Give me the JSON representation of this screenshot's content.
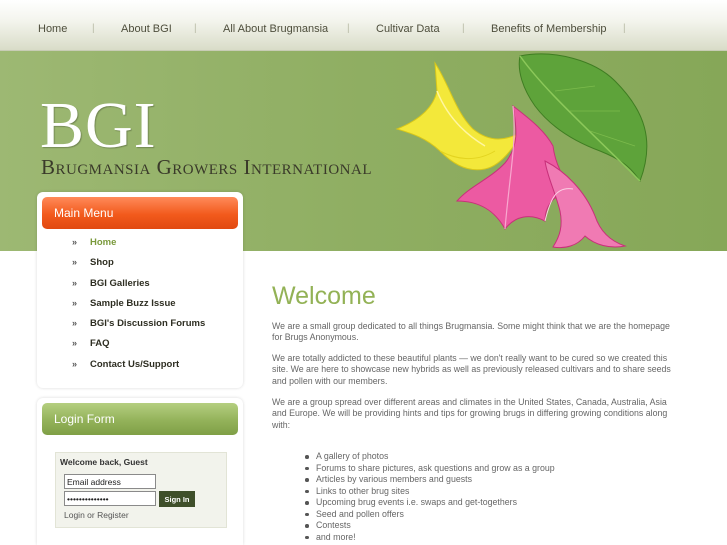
{
  "nav": {
    "items": [
      "Home",
      "About BGI",
      "All About Brugmansia",
      "Cultivar Data",
      "Benefits of Membership"
    ],
    "separator": "|"
  },
  "header": {
    "logo": "BGI",
    "subtitle": "Brugmansia Growers International"
  },
  "main_menu": {
    "title": "Main Menu",
    "arrow": "»",
    "items": [
      "Home",
      "Shop",
      "BGI Galleries",
      "Sample Buzz Issue",
      "BGI's Discussion Forums",
      "FAQ",
      "Contact Us/Support"
    ],
    "active_index": 0
  },
  "login": {
    "title": "Login Form",
    "welcome": "Welcome back, Guest",
    "email_value": "Email address",
    "password_value": "••••••••••••••",
    "signin_label": "Sign In",
    "links_text": "Login or Register"
  },
  "main": {
    "title": "Welcome",
    "paragraphs": [
      "We are a small group dedicated to all things Brugmansia. Some might think that we are the homepage for Brugs Anonymous.",
      "We are totally addicted to these beautiful plants — we don't really want to be cured so we created this site. We are here to showcase new hybrids as well as previously released cultivars and to share seeds and pollen with our members.",
      "We are a group spread over different areas and climates in the United States, Canada, Australia, Asia and Europe. We will be providing hints and tips for growing brugs in differing growing conditions along with:"
    ],
    "bullets": [
      "A gallery of photos",
      "Forums to share pictures, ask questions and grow as a group",
      "Articles by various members and guests",
      "Links to other brug sites",
      "Upcoming brug events i.e. swaps and get-togethers",
      "Seed and pollen offers",
      "Contests",
      "and more!"
    ]
  },
  "colors": {
    "header_green": "#8fae62",
    "menu_orange": "#f25a1c",
    "login_green": "#93b25a",
    "title_green": "#93b256",
    "active_link": "#7a9a3c"
  }
}
